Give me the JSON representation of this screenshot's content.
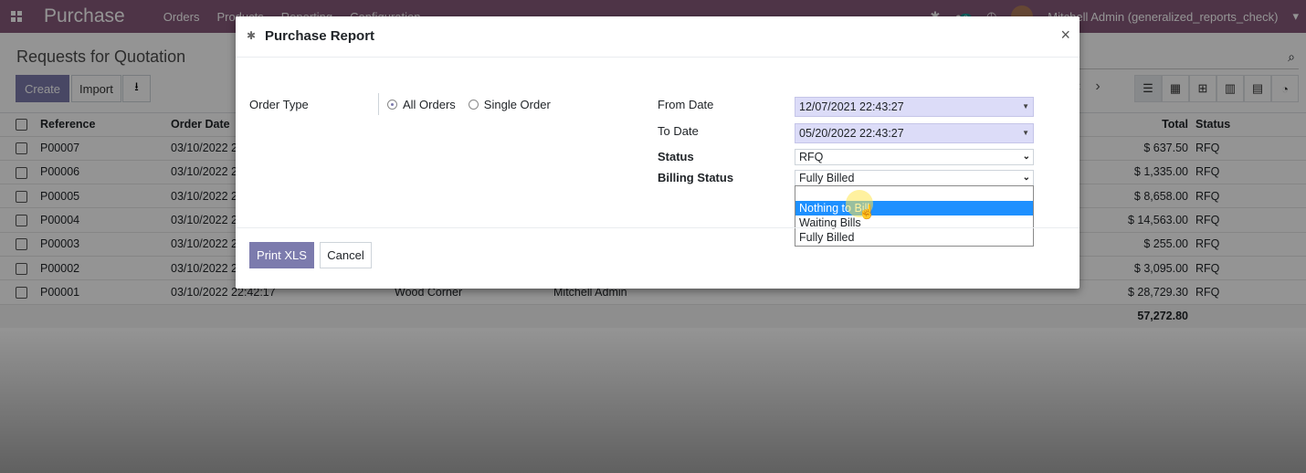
{
  "topbar": {
    "app_name": "Purchase",
    "menu": [
      "Orders",
      "Products",
      "Reporting",
      "Configuration"
    ],
    "activity_count": "2",
    "user": "Mitchell Admin (generalized_reports_check)",
    "icons": [
      "apps-icon",
      "bug-icon",
      "chat-icon",
      "clock-icon",
      "avatar",
      "caret-down-icon"
    ]
  },
  "control_panel": {
    "breadcrumb": "Requests for Quotation",
    "create_label": "Create",
    "import_label": "Import",
    "download_icon": "download-icon",
    "search_icon": "search-icon",
    "pager_prev": "‹",
    "pager_next": "›",
    "views": [
      "list-view-icon",
      "kanban-view-icon",
      "pivot-view-icon",
      "graph-view-icon",
      "calendar-view-icon",
      "activity-view-icon"
    ]
  },
  "table": {
    "columns": [
      "Reference",
      "Order Date",
      "",
      "",
      "Total",
      "Status"
    ],
    "rows": [
      {
        "ref": "P00007",
        "date": "03/10/2022 2",
        "vendor": "",
        "buyer": "",
        "total": "$ 637.50",
        "status": "RFQ"
      },
      {
        "ref": "P00006",
        "date": "03/10/2022 2",
        "vendor": "",
        "buyer": "",
        "total": "$ 1,335.00",
        "status": "RFQ"
      },
      {
        "ref": "P00005",
        "date": "03/10/2022 2",
        "vendor": "",
        "buyer": "",
        "total": "$ 8,658.00",
        "status": "RFQ"
      },
      {
        "ref": "P00004",
        "date": "03/10/2022 2",
        "vendor": "",
        "buyer": "",
        "total": "$ 14,563.00",
        "status": "RFQ"
      },
      {
        "ref": "P00003",
        "date": "03/10/2022 2",
        "vendor": "",
        "buyer": "",
        "total": "$ 255.00",
        "status": "RFQ"
      },
      {
        "ref": "P00002",
        "date": "03/10/2022 2",
        "vendor": "",
        "buyer": "",
        "total": "$ 3,095.00",
        "status": "RFQ"
      },
      {
        "ref": "P00001",
        "date": "03/10/2022 22:42:17",
        "vendor": "Wood Corner",
        "buyer": "Mitchell Admin",
        "total": "$ 28,729.30",
        "status": "RFQ"
      }
    ],
    "grand_total": "57,272.80"
  },
  "modal": {
    "title": "Purchase Report",
    "title_icon": "bug-icon",
    "close_icon": "×",
    "order_type_label": "Order Type",
    "order_type_options": [
      {
        "label": "All Orders",
        "checked": true
      },
      {
        "label": "Single Order",
        "checked": false
      }
    ],
    "from_date_label": "From Date",
    "from_date_value": "12/07/2021 22:43:27",
    "to_date_label": "To Date",
    "to_date_value": "05/20/2022 22:43:27",
    "status_label": "Status",
    "status_value": "RFQ",
    "billing_status_label": "Billing Status",
    "billing_status_value": "Fully Billed",
    "billing_options": [
      "",
      "Nothing to Bill",
      "Waiting Bills",
      "Fully Billed"
    ],
    "billing_highlighted": "Nothing to Bill",
    "print_label": "Print XLS",
    "cancel_label": "Cancel"
  },
  "colors": {
    "brand": "#875a7b",
    "primary_button": "#7c7bad",
    "date_field_bg": "#dcdcf8",
    "dropdown_highlight": "#1e90ff"
  }
}
